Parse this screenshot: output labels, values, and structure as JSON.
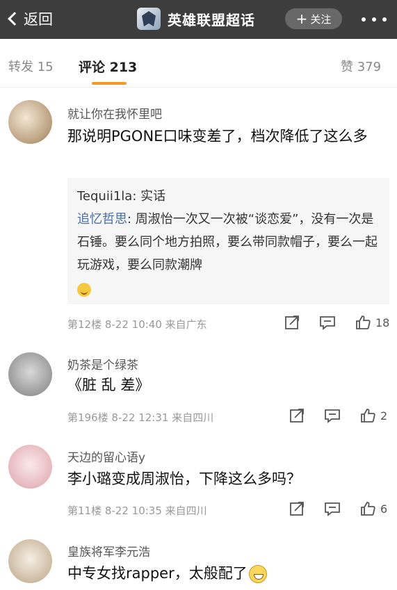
{
  "header": {
    "back_label": "返回",
    "title": "英雄联盟超话",
    "follow_label": "关注",
    "follow_plus": "+"
  },
  "tabs": {
    "repost": "转发 15",
    "comments": "评论 213",
    "likes": "赞 379"
  },
  "comments": [
    {
      "username": "就让你在我怀里吧",
      "text": "那说明PGONE口味变差了，档次降低了这么多",
      "quote": {
        "line1_author": "Tequii1la",
        "line1_text": ": 实话",
        "line2_author": "追忆哲思",
        "line2_text": ": 周淑怡一次又一次被“谈恋爱”，没有一次是石锤。要么同个地方拍照，要么带同款帽子，要么一起玩游戏，要么同款潮牌"
      },
      "meta": "第12楼  8-22 10:40  来自广东",
      "likes": "18"
    },
    {
      "username": "奶茶是个绿茶",
      "text": "《脏 乱 差》",
      "meta": "第196楼  8-22 12:31  来自四川",
      "likes": "2"
    },
    {
      "username": "天边的留心语y",
      "text": "李小璐变成周淑怡，下降这么多吗？",
      "meta": "第11楼  8-22 10:35  来自四川",
      "likes": "6"
    },
    {
      "username": "皇族将军李元浩",
      "text": "中专女找rapper，太般配了"
    }
  ],
  "icons": {
    "back": "chevron-left-icon",
    "more": "more-dots-icon",
    "repost": "repost-icon",
    "reply": "comment-icon",
    "like": "thumbs-up-icon",
    "emoji": "grin-emoji-icon"
  }
}
